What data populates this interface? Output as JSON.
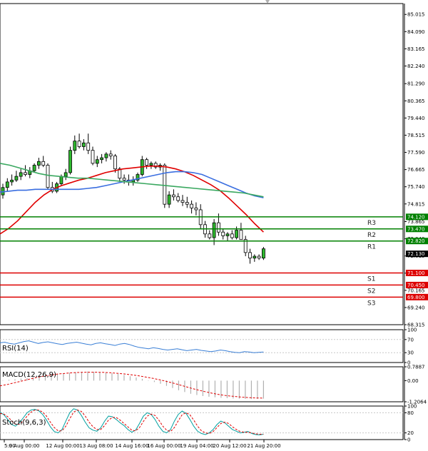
{
  "chart_data": [
    {
      "type": "candlestick",
      "title": "",
      "ylim": [
        68.315,
        85.6
      ],
      "y_ticks": [
        "85.015",
        "84.090",
        "83.165",
        "82.240",
        "81.290",
        "80.365",
        "79.440",
        "78.515",
        "77.590",
        "76.665",
        "75.740",
        "74.815",
        "73.865",
        "72.940",
        "72.015",
        "71.090",
        "70.165",
        "69.240",
        "68.315"
      ],
      "x_ticks": [
        "5:00",
        "9 Aug 00:00",
        "12 Aug 00:00",
        "13 Aug 08:00",
        "14 Aug 16:00",
        "16 Aug 00:00",
        "19 Aug 04:00",
        "20 Aug 12:00",
        "21 Aug 20:00"
      ],
      "current_price": "72.130",
      "levels": [
        {
          "name": "R3",
          "value": 74.12,
          "label": "74.120",
          "color": "#008000"
        },
        {
          "name": "R2",
          "value": 73.47,
          "label": "73.470",
          "color": "#008000"
        },
        {
          "name": "R1",
          "value": 72.82,
          "label": "72.820",
          "color": "#008000"
        },
        {
          "name": "S1",
          "value": 71.1,
          "label": "71.100",
          "color": "#dd0000"
        },
        {
          "name": "S2",
          "value": 70.45,
          "label": "70.450",
          "color": "#dd0000"
        },
        {
          "name": "S3",
          "value": 69.8,
          "label": "69.800",
          "color": "#dd0000"
        }
      ],
      "candles": [
        [
          75.3,
          75.9,
          75.1,
          75.7
        ],
        [
          75.7,
          76.2,
          75.5,
          76.0
        ],
        [
          76.0,
          76.4,
          75.8,
          76.1
        ],
        [
          76.1,
          76.6,
          76.0,
          76.3
        ],
        [
          76.3,
          76.7,
          76.1,
          76.5
        ],
        [
          76.5,
          76.9,
          76.3,
          76.4
        ],
        [
          76.4,
          76.8,
          76.2,
          76.6
        ],
        [
          76.6,
          77.0,
          76.5,
          76.9
        ],
        [
          76.9,
          77.3,
          76.7,
          77.1
        ],
        [
          77.1,
          77.4,
          76.8,
          76.9
        ],
        [
          76.9,
          77.0,
          75.6,
          75.7
        ],
        [
          75.7,
          76.0,
          75.4,
          75.5
        ],
        [
          75.5,
          76.0,
          75.4,
          75.9
        ],
        [
          75.9,
          76.4,
          75.8,
          76.3
        ],
        [
          76.3,
          76.7,
          76.1,
          76.5
        ],
        [
          76.5,
          77.9,
          76.4,
          77.7
        ],
        [
          77.7,
          78.5,
          77.5,
          78.2
        ],
        [
          78.2,
          78.6,
          77.8,
          77.9
        ],
        [
          77.9,
          78.3,
          77.7,
          78.1
        ],
        [
          78.1,
          78.6,
          77.5,
          77.7
        ],
        [
          77.7,
          77.9,
          76.9,
          77.0
        ],
        [
          77.0,
          77.4,
          76.8,
          77.2
        ],
        [
          77.2,
          77.5,
          77.0,
          77.3
        ],
        [
          77.3,
          77.6,
          77.1,
          77.5
        ],
        [
          77.5,
          77.7,
          77.2,
          77.4
        ],
        [
          77.4,
          77.5,
          76.5,
          76.7
        ],
        [
          76.7,
          76.8,
          76.0,
          76.2
        ],
        [
          76.2,
          76.4,
          75.9,
          76.1
        ],
        [
          76.1,
          76.4,
          75.8,
          76.0
        ],
        [
          76.0,
          76.3,
          75.8,
          76.1
        ],
        [
          76.1,
          76.5,
          76.0,
          76.4
        ],
        [
          76.4,
          77.4,
          76.3,
          77.2
        ],
        [
          77.2,
          77.3,
          76.7,
          76.9
        ],
        [
          76.9,
          77.1,
          76.7,
          77.0
        ],
        [
          77.0,
          77.1,
          76.7,
          76.8
        ],
        [
          76.8,
          77.0,
          76.6,
          76.9
        ],
        [
          76.9,
          77.0,
          74.6,
          74.8
        ],
        [
          74.8,
          75.5,
          74.6,
          75.3
        ],
        [
          75.3,
          75.6,
          75.0,
          75.2
        ],
        [
          75.2,
          75.4,
          74.9,
          75.0
        ],
        [
          75.0,
          75.3,
          74.7,
          74.9
        ],
        [
          74.9,
          75.2,
          74.6,
          74.8
        ],
        [
          74.8,
          75.0,
          74.3,
          74.6
        ],
        [
          74.6,
          74.9,
          74.2,
          74.5
        ],
        [
          74.5,
          74.8,
          73.5,
          73.7
        ],
        [
          73.7,
          73.9,
          73.0,
          73.2
        ],
        [
          73.2,
          73.4,
          72.9,
          73.0
        ],
        [
          73.0,
          74.0,
          72.6,
          73.8
        ],
        [
          73.8,
          74.3,
          73.1,
          73.3
        ],
        [
          73.3,
          73.5,
          72.9,
          73.1
        ],
        [
          73.1,
          73.3,
          72.8,
          73.2
        ],
        [
          73.2,
          73.4,
          72.9,
          73.0
        ],
        [
          73.0,
          73.6,
          72.9,
          73.4
        ],
        [
          73.4,
          73.8,
          73.2,
          72.9
        ],
        [
          72.9,
          73.1,
          72.0,
          72.2
        ],
        [
          72.2,
          72.4,
          71.6,
          71.9
        ],
        [
          71.9,
          72.1,
          71.7,
          72.0
        ],
        [
          72.0,
          72.1,
          71.8,
          71.9
        ],
        [
          71.9,
          72.5,
          71.8,
          72.4
        ]
      ],
      "series": [
        {
          "name": "",
          "color": "#e00000",
          "values": [
            73.2,
            73.5,
            73.9,
            74.4,
            74.9,
            75.3,
            75.6,
            75.8,
            75.95,
            76.1,
            76.2,
            76.35,
            76.5,
            76.6,
            76.7,
            76.75,
            76.8,
            76.85,
            76.85,
            76.8,
            76.7,
            76.55,
            76.35,
            76.1,
            75.85,
            75.55,
            75.15,
            74.7,
            74.25,
            73.75,
            73.3
          ]
        },
        {
          "name": "",
          "color": "#3a6ee0",
          "values": [
            75.45,
            75.5,
            75.55,
            75.55,
            75.6,
            75.6,
            75.6,
            75.6,
            75.6,
            75.6,
            75.65,
            75.7,
            75.8,
            75.9,
            76.0,
            76.1,
            76.2,
            76.3,
            76.4,
            76.5,
            76.55,
            76.55,
            76.5,
            76.4,
            76.2,
            76.0,
            75.8,
            75.6,
            75.4,
            75.25,
            75.15
          ]
        },
        {
          "name": "",
          "color": "#3aa860",
          "values": [
            77.0,
            76.9,
            76.75,
            76.6,
            76.45,
            76.35,
            76.3,
            76.25,
            76.2,
            76.2,
            76.15,
            76.1,
            76.05,
            76.0,
            75.95,
            75.9,
            75.85,
            75.8,
            75.75,
            75.7,
            75.65,
            75.6,
            75.55,
            75.5,
            75.45,
            75.4,
            75.3,
            75.2
          ]
        }
      ]
    },
    {
      "type": "line",
      "title": "RSI(14)",
      "ylim": [
        0,
        100
      ],
      "y_ticks": [
        "100",
        "70",
        "30",
        "0"
      ],
      "series": [
        {
          "name": "",
          "color": "#3a7fd6",
          "values": [
            60,
            62,
            58,
            56,
            60,
            64,
            66,
            62,
            58,
            61,
            63,
            60,
            57,
            55,
            58,
            60,
            62,
            59,
            56,
            54,
            58,
            60,
            57,
            55,
            52,
            56,
            58,
            55,
            50,
            46,
            44,
            42,
            45,
            43,
            40,
            38,
            40,
            42,
            39,
            36,
            38,
            40,
            37,
            35,
            33,
            35,
            38,
            36,
            33,
            31,
            30,
            33,
            32,
            30,
            31,
            32
          ]
        }
      ]
    },
    {
      "type": "bar",
      "title": "MACD(12,26,9)",
      "ylim": [
        -1.2064,
        0.7887
      ],
      "y_ticks": [
        "0.7887",
        "0.00",
        "-1.2064"
      ],
      "histogram": [
        0.02,
        0.05,
        0.08,
        0.12,
        0.15,
        0.2,
        0.25,
        0.3,
        0.35,
        0.4,
        0.42,
        0.45,
        0.48,
        0.5,
        0.52,
        0.5,
        0.48,
        0.45,
        0.42,
        0.38,
        0.32,
        0.25,
        0.18,
        0.1,
        0.02,
        -0.08,
        -0.18,
        -0.3,
        -0.42,
        -0.55,
        -0.65,
        -0.75,
        -0.82,
        -0.88,
        -0.92,
        -0.95,
        -0.98,
        -1.0,
        -1.02,
        -1.03,
        -1.04,
        -1.05,
        -1.04,
        -1.03
      ],
      "series": [
        {
          "name": "",
          "color": "#e00000",
          "values": [
            -0.3,
            -0.22,
            -0.12,
            -0.02,
            0.08,
            0.18,
            0.26,
            0.32,
            0.38,
            0.42,
            0.45,
            0.47,
            0.48,
            0.48,
            0.47,
            0.45,
            0.42,
            0.38,
            0.33,
            0.27,
            0.2,
            0.12,
            0.03,
            -0.07,
            -0.18,
            -0.3,
            -0.42,
            -0.53,
            -0.63,
            -0.72,
            -0.8,
            -0.86,
            -0.9,
            -0.94,
            -0.97,
            -0.99,
            -1.0
          ]
        }
      ]
    },
    {
      "type": "line",
      "title": "Stoch(9,6,3)",
      "ylim": [
        0,
        100
      ],
      "y_ticks": [
        "100",
        "80",
        "20",
        "0"
      ],
      "series": [
        {
          "name": "",
          "color": "#00a0a0",
          "values": [
            82,
            74,
            60,
            45,
            40,
            50,
            65,
            80,
            88,
            90,
            86,
            75,
            58,
            38,
            24,
            20,
            30,
            55,
            80,
            92,
            88,
            72,
            52,
            35,
            28,
            25,
            35,
            55,
            70,
            68,
            60,
            50,
            42,
            30,
            22,
            28,
            48,
            70,
            80,
            75,
            60,
            40,
            25,
            20,
            30,
            55,
            75,
            85,
            78,
            60,
            40,
            25,
            18,
            15,
            20,
            30,
            45,
            55,
            50,
            40,
            30,
            25,
            20,
            22,
            24,
            18,
            15,
            14,
            16
          ]
        },
        {
          "name": "",
          "color": "#e00000",
          "values": [
            78,
            76,
            68,
            56,
            46,
            46,
            56,
            70,
            82,
            88,
            88,
            82,
            70,
            52,
            36,
            26,
            26,
            40,
            62,
            82,
            88,
            84,
            70,
            52,
            38,
            30,
            30,
            42,
            58,
            66,
            66,
            58,
            48,
            38,
            28,
            26,
            36,
            54,
            70,
            76,
            72,
            58,
            40,
            28,
            24,
            36,
            56,
            74,
            80,
            74,
            58,
            40,
            26,
            20,
            18,
            24,
            36,
            48,
            52,
            48,
            38,
            30,
            24,
            22,
            22,
            20,
            17,
            16,
            16
          ]
        }
      ]
    }
  ]
}
